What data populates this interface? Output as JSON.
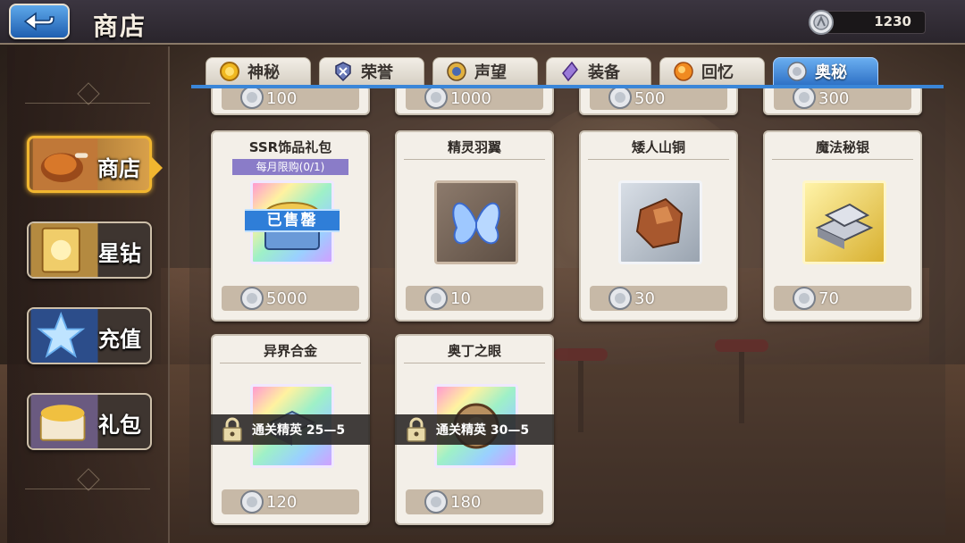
{
  "header": {
    "title": "商店",
    "currency_value": "1230"
  },
  "sidebar": {
    "items": [
      {
        "label": "商店",
        "active": true
      },
      {
        "label": "星钻",
        "active": false
      },
      {
        "label": "充值",
        "active": false
      },
      {
        "label": "礼包",
        "active": false
      }
    ]
  },
  "tabs": [
    {
      "label": "神秘",
      "icon": "gold-coin-icon",
      "active": false
    },
    {
      "label": "荣誉",
      "icon": "honor-crest-icon",
      "active": false
    },
    {
      "label": "声望",
      "icon": "reputation-medal-icon",
      "active": false
    },
    {
      "label": "装备",
      "icon": "equipment-crystal-icon",
      "active": false
    },
    {
      "label": "回忆",
      "icon": "memory-orb-icon",
      "active": false
    },
    {
      "label": "奥秘",
      "icon": "arcane-coin-icon",
      "active": true
    }
  ],
  "top_row_prices": [
    "100",
    "1000",
    "500",
    "300"
  ],
  "items": [
    {
      "name": "SSR饰品礼包",
      "limit": "每月限购(0/1)",
      "price": "5000",
      "status": "已售罄",
      "icon": "ssr-accessory-chest-icon"
    },
    {
      "name": "精灵羽翼",
      "price": "10",
      "icon": "fairy-wings-icon"
    },
    {
      "name": "矮人山铜",
      "price": "30",
      "icon": "dwarf-copper-ore-icon"
    },
    {
      "name": "魔法秘银",
      "price": "70",
      "icon": "mithril-ingot-icon"
    },
    {
      "name": "异界合金",
      "price": "120",
      "lock": "通关精英  25—5",
      "icon": "otherworld-alloy-icon"
    },
    {
      "name": "奥丁之眼",
      "price": "180",
      "lock": "通关精英  30—5",
      "icon": "odin-eye-icon"
    }
  ]
}
